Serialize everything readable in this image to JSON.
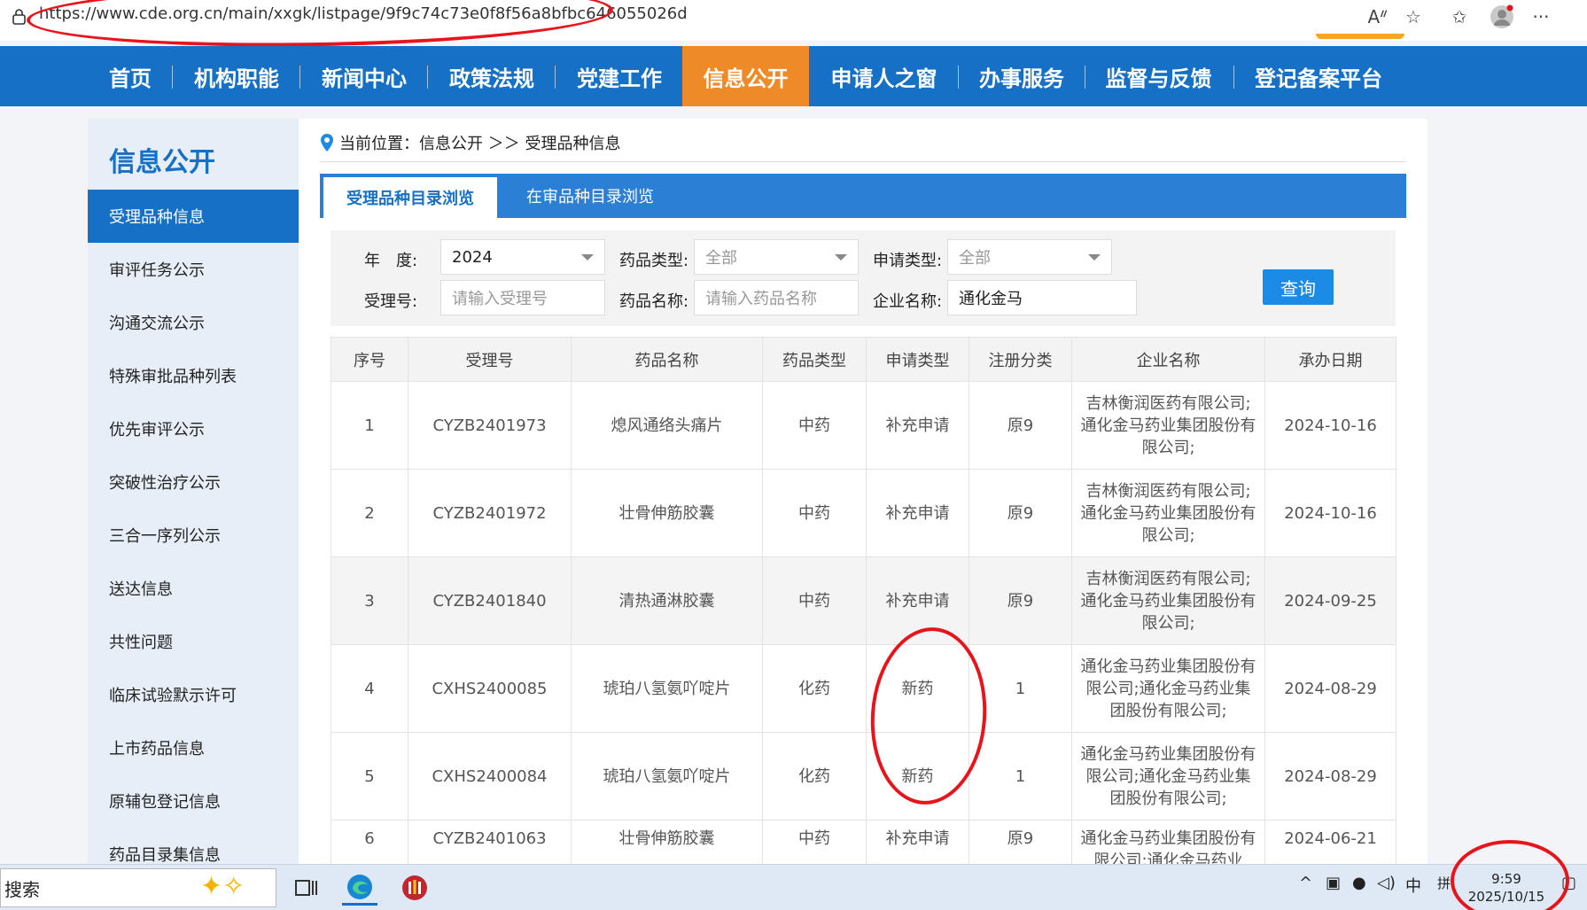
{
  "browser": {
    "url": "https://www.cde.org.cn/main/xxgk/listpage/9f9c74c73e0f8f56a8bfbc646055026d",
    "icons": [
      "lock-icon",
      "read-aloud-icon",
      "favorite-icon",
      "favorites-bar-icon",
      "profile-icon",
      "more-icon"
    ]
  },
  "nav": {
    "items": [
      "首页",
      "机构职能",
      "新闻中心",
      "政策法规",
      "党建工作",
      "信息公开",
      "申请人之窗",
      "办事服务",
      "监督与反馈",
      "登记备案平台"
    ],
    "active": "信息公开",
    "bg_color": "#1670c6",
    "active_color": "#ef8a28"
  },
  "sidebar": {
    "title": "信息公开",
    "items": [
      "受理品种信息",
      "审评任务公示",
      "沟通交流公示",
      "特殊审批品种列表",
      "优先审评公示",
      "突破性治疗公示",
      "三合一序列公示",
      "送达信息",
      "共性问题",
      "临床试验默示许可",
      "上市药品信息",
      "原辅包登记信息",
      "药品目录集信息"
    ],
    "active": "受理品种信息"
  },
  "breadcrumb": {
    "prefix": "当前位置：信息公开 ＞＞ 受理品种信息"
  },
  "tabs": [
    "受理品种目录浏览",
    "在审品种目录浏览"
  ],
  "filters": {
    "year_label": "年　度:",
    "year_value": "2024",
    "drug_type_label": "药品类型:",
    "drug_type_value": "全部",
    "apply_type_label": "申请类型:",
    "apply_type_value": "全部",
    "accept_no_label": "受理号:",
    "accept_no_placeholder": "请输入受理号",
    "drug_name_label": "药品名称:",
    "drug_name_placeholder": "请输入药品名称",
    "company_label": "企业名称:",
    "company_value": "通化金马",
    "search_label": "查询"
  },
  "table": {
    "headers": [
      "序号",
      "受理号",
      "药品名称",
      "药品类型",
      "申请类型",
      "注册分类",
      "企业名称",
      "承办日期"
    ],
    "rows": [
      [
        "1",
        "CYZB2401973",
        "熄风通络头痛片",
        "中药",
        "补充申请",
        "原9",
        "吉林衡润医药有限公司;通化金马药业集团股份有限公司;",
        "2024-10-16"
      ],
      [
        "2",
        "CYZB2401972",
        "壮骨伸筋胶囊",
        "中药",
        "补充申请",
        "原9",
        "吉林衡润医药有限公司;通化金马药业集团股份有限公司;",
        "2024-10-16"
      ],
      [
        "3",
        "CYZB2401840",
        "清热通淋胶囊",
        "中药",
        "补充申请",
        "原9",
        "吉林衡润医药有限公司;通化金马药业集团股份有限公司;",
        "2024-09-25"
      ],
      [
        "4",
        "CXHS2400085",
        "琥珀八氢氨吖啶片",
        "化药",
        "新药",
        "1",
        "通化金马药业集团股份有限公司;通化金马药业集团股份有限公司;",
        "2024-08-29"
      ],
      [
        "5",
        "CXHS2400084",
        "琥珀八氢氨吖啶片",
        "化药",
        "新药",
        "1",
        "通化金马药业集团股份有限公司;通化金马药业集团股份有限公司;",
        "2024-08-29"
      ],
      [
        "6",
        "CYZB2401063",
        "壮骨伸筋胶囊",
        "中药",
        "补充申请",
        "原9",
        "通化金马药业集团股份有限公司;通化金马药业",
        "2024-06-21"
      ]
    ]
  },
  "taskbar": {
    "search_label": "搜索",
    "ime_label": "中",
    "ime_mode": "拼",
    "time": "9:59",
    "date": "2025/10/15"
  },
  "annotation_color": "#e8141c"
}
